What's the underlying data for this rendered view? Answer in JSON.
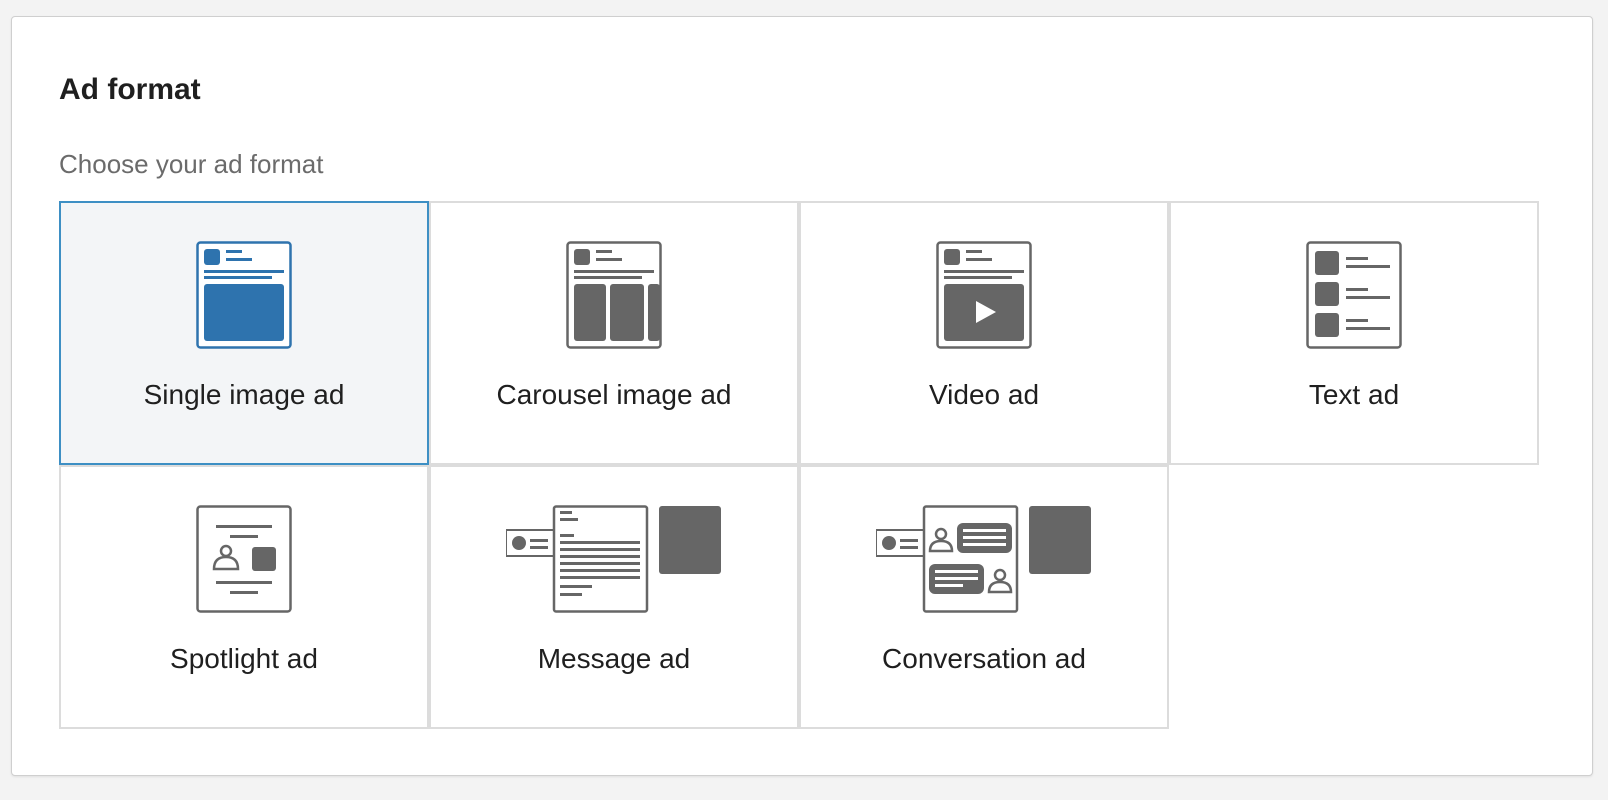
{
  "header": {
    "title": "Ad format",
    "subtitle": "Choose your ad format"
  },
  "formats": [
    {
      "label": "Single image ad",
      "icon": "single-image-ad-icon",
      "selected": true
    },
    {
      "label": "Carousel image ad",
      "icon": "carousel-image-ad-icon",
      "selected": false
    },
    {
      "label": "Video ad",
      "icon": "video-ad-icon",
      "selected": false
    },
    {
      "label": "Text ad",
      "icon": "text-ad-icon",
      "selected": false
    },
    {
      "label": "Spotlight ad",
      "icon": "spotlight-ad-icon",
      "selected": false
    },
    {
      "label": "Message ad",
      "icon": "message-ad-icon",
      "selected": false
    },
    {
      "label": "Conversation ad",
      "icon": "conversation-ad-icon",
      "selected": false
    }
  ],
  "colors": {
    "accent": "#2e73ae",
    "selected_border": "#3d8fc4",
    "selected_bg": "#f3f5f7",
    "icon_gray": "#666666"
  }
}
